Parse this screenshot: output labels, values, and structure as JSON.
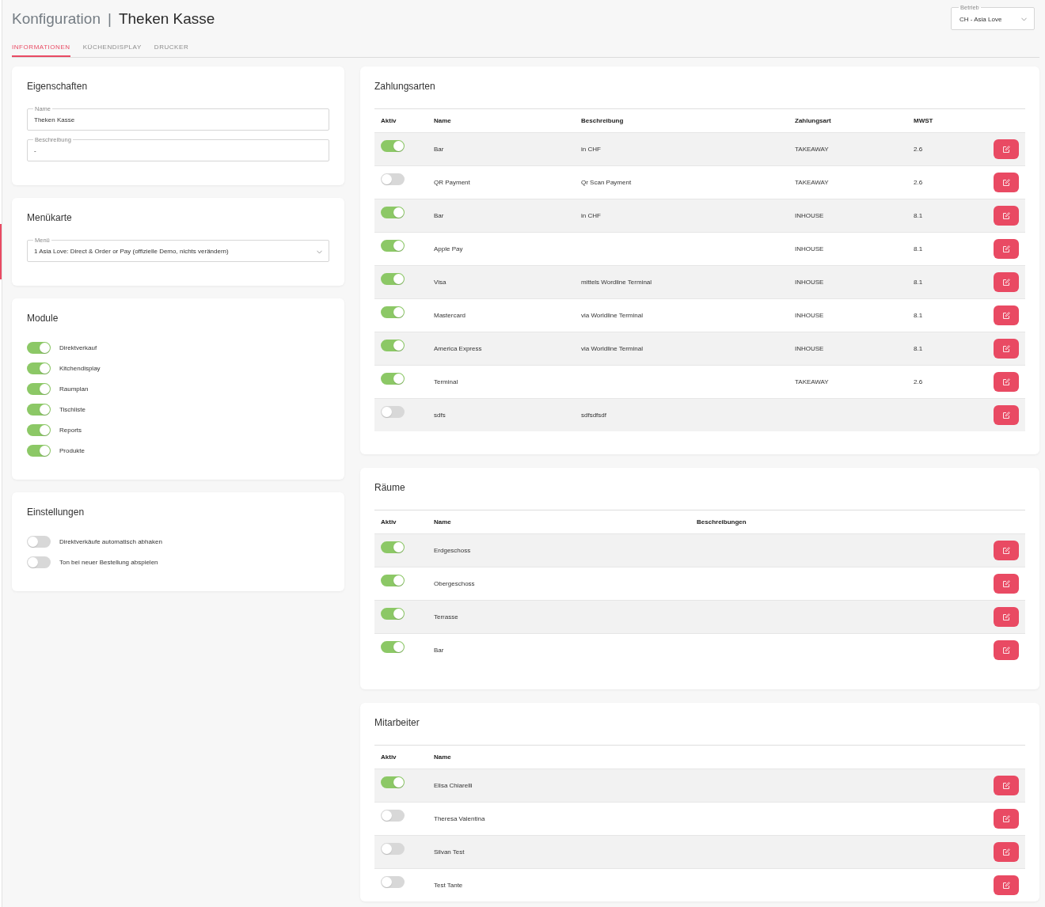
{
  "header": {
    "title": "Konfiguration",
    "separator": "|",
    "subtitle": "Theken Kasse",
    "business_select": {
      "label": "Betrieb",
      "value": "CH - Asia Love"
    }
  },
  "tabs": [
    {
      "label": "INFORMATIONEN",
      "selected": true
    },
    {
      "label": "KÜCHENDISPLAY",
      "selected": false
    },
    {
      "label": "DRUCKER",
      "selected": false
    }
  ],
  "properties": {
    "title": "Eigenschaften",
    "fields": [
      {
        "label": "Name",
        "value": "Theken Kasse"
      },
      {
        "label": "Beschreibung",
        "value": "-"
      }
    ]
  },
  "menu_card": {
    "title": "Menükarte",
    "select": {
      "label": "Menü",
      "value": "1 Asia Love: Direct & Order or Pay (offizielle Demo, nichts verändern)"
    }
  },
  "modules": {
    "title": "Module",
    "items": [
      {
        "label": "Direktverkauf",
        "on": true
      },
      {
        "label": "Kitchendisplay",
        "on": true
      },
      {
        "label": "Raumplan",
        "on": true
      },
      {
        "label": "Tischliste",
        "on": true
      },
      {
        "label": "Reports",
        "on": true
      },
      {
        "label": "Produkte",
        "on": true
      }
    ]
  },
  "settings": {
    "title": "Einstellungen",
    "items": [
      {
        "label": "Direktverkäufe automatisch abhaken",
        "on": false
      },
      {
        "label": "Ton bei neuer Bestellung abspielen",
        "on": false
      }
    ]
  },
  "payment_methods": {
    "title": "Zahlungsarten",
    "columns": [
      "Aktiv",
      "Name",
      "Beschreibung",
      "Zahlungsart",
      "MWST"
    ],
    "rows": [
      {
        "active": true,
        "name": "Bar",
        "description": "in CHF",
        "payment_type": "TAKEAWAY",
        "vat": "2.6"
      },
      {
        "active": false,
        "name": "QR Payment",
        "description": "Qr Scan Payment",
        "payment_type": "TAKEAWAY",
        "vat": "2.6"
      },
      {
        "active": true,
        "name": "Bar",
        "description": "in CHF",
        "payment_type": "INHOUSE",
        "vat": "8.1"
      },
      {
        "active": true,
        "name": "Apple Pay",
        "payment_type": "INHOUSE",
        "vat": "8.1"
      },
      {
        "active": true,
        "name": "Visa",
        "description": "mittels Wordline Terminal",
        "payment_type": "INHOUSE",
        "vat": "8.1"
      },
      {
        "active": true,
        "name": "Mastercard",
        "description": "via Worldline Terminal",
        "payment_type": "INHOUSE",
        "vat": "8.1"
      },
      {
        "active": true,
        "name": "America Express",
        "description": "via Worldline Terminal",
        "payment_type": "INHOUSE",
        "vat": "8.1"
      },
      {
        "active": true,
        "name": "Terminal",
        "payment_type": "TAKEAWAY",
        "vat": "2.6"
      },
      {
        "active": false,
        "name": "sdfs",
        "description": "sdfsdfsdf"
      }
    ]
  },
  "rooms": {
    "title": "Räume",
    "columns": [
      "Aktiv",
      "Name",
      "Beschreibungen"
    ],
    "rows": [
      {
        "active": true,
        "name": "Erdgeschoss"
      },
      {
        "active": true,
        "name": "Obergeschoss"
      },
      {
        "active": true,
        "name": "Terrasse"
      },
      {
        "active": true,
        "name": "Bar"
      }
    ]
  },
  "staff": {
    "title": "Mitarbeiter",
    "columns": [
      "Aktiv",
      "Name"
    ],
    "rows": [
      {
        "active": true,
        "name": "Elisa Chiarelli"
      },
      {
        "active": false,
        "name": "Theresa Valentina"
      },
      {
        "active": false,
        "name": "Silvan Test"
      },
      {
        "active": false,
        "name": "Test Tante"
      }
    ]
  }
}
